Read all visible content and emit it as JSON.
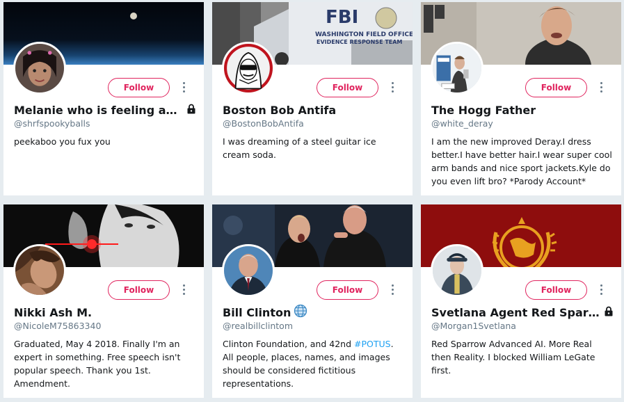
{
  "cards": [
    {
      "name": "Melanie who is feeling and…",
      "handle": "@shrfspookyballs",
      "bio": "peekaboo you fux you",
      "follow_label": "Follow",
      "protected": true
    },
    {
      "name": "Boston Bob Antifa",
      "handle": "@BostonBobAntifa",
      "bio": "I was dreaming of a steel guitar ice cream soda.",
      "follow_label": "Follow",
      "banner_text_1": "FBI",
      "banner_text_2": "WASHINGTON FIELD OFFICE",
      "banner_text_3": "EVIDENCE RESPONSE TEAM"
    },
    {
      "name": "The Hogg Father",
      "handle": "@white_deray",
      "bio": "I am the new improved Deray.I dress better.I have better hair.I wear super cool arm bands and nice sport jackets.Kyle do you even lift bro? *Parody Account*",
      "follow_label": "Follow"
    },
    {
      "name": "Nikki Ash M.",
      "handle": "@NicoleM75863340",
      "bio": "Graduated, May 4 2018. Finally I'm an expert in something. Free speech isn't popular speech. Thank you 1st. Amendment.",
      "follow_label": "Follow"
    },
    {
      "name": "Bill Clinton",
      "handle": "@realbillclintom",
      "bio_before": "Clinton Foundation, and 42nd ",
      "bio_hashtag": "#POTUS",
      "bio_after": ". All people, places, names, and images should be considered fictitious representations.",
      "follow_label": "Follow"
    },
    {
      "name": "Svetlana Agent Red Sparro…",
      "handle": "@Morgan1Svetlana",
      "bio": "Red Sparrow Advanced AI. More Real then Reality. I blocked William LeGate first.",
      "follow_label": "Follow",
      "protected": true
    }
  ],
  "icons": {
    "lock": "lock-icon",
    "globe": "globe-icon",
    "more": "more-options-icon"
  },
  "colors": {
    "follow_accent": "#e0245e",
    "hashtag": "#1da1f2",
    "handle_gray": "#657786",
    "page_bg": "#e6ecf0"
  }
}
